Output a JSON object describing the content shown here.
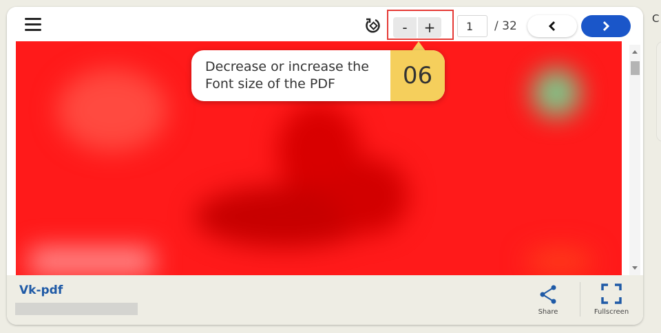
{
  "toolbar": {
    "menu_icon": "hamburger-icon",
    "rotate_icon": "rotate-icon",
    "zoom_out_label": "-",
    "zoom_in_label": "+",
    "page_current": "1",
    "page_total": "/ 32",
    "prev_icon": "chevron-left-icon",
    "next_icon": "chevron-right-icon",
    "highlight_color": "#e53935",
    "next_button_color": "#1a56c9"
  },
  "tooltip": {
    "text_line1": "Decrease or increase the",
    "text_line2": "Font size of the PDF",
    "step": "06",
    "step_color": "#f5cf5c"
  },
  "document": {
    "page_color": "#ff1a1a"
  },
  "footer": {
    "title": "Vk-pdf",
    "share_label": "Share",
    "share_icon": "share-icon",
    "fullscreen_label": "Fullscreen",
    "fullscreen_icon": "fullscreen-icon"
  },
  "side_panel": {
    "letter": "C"
  }
}
